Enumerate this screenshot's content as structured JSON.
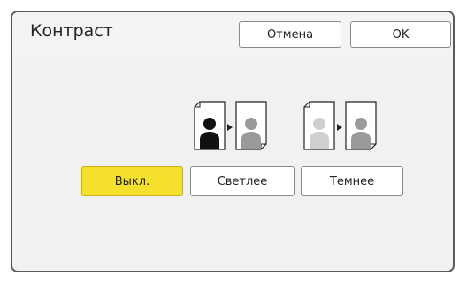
{
  "dialog": {
    "title": "Контраст",
    "cancel_label": "Отмена",
    "ok_label": "OK"
  },
  "options": [
    {
      "label": "Выкл.",
      "selected": true
    },
    {
      "label": "Светлее",
      "selected": false
    },
    {
      "label": "Темнее",
      "selected": false
    }
  ],
  "colors": {
    "selected": "#f5e02e",
    "frame": "#5a5a5a",
    "panel": "#f1f1f1"
  }
}
